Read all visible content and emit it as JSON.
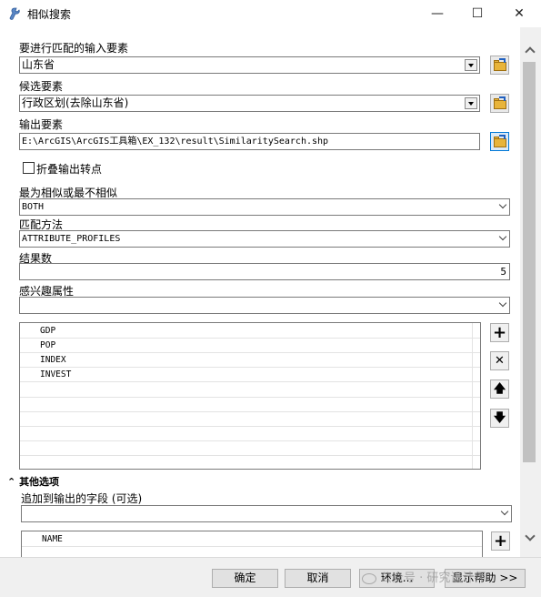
{
  "window": {
    "title": "相似搜索",
    "minimize_glyph": "—",
    "maximize_glyph": "☐",
    "close_glyph": "✕"
  },
  "fields": {
    "input_features": {
      "label": "要进行匹配的输入要素",
      "value": "山东省"
    },
    "candidate_features": {
      "label": "候选要素",
      "value": "行政区划(去除山东省)"
    },
    "output_features": {
      "label": "输出要素",
      "value": "E:\\ArcGIS\\ArcGIS工具箱\\EX_132\\result\\SimilaritySearch.shp"
    },
    "collapse_checkbox": {
      "label": "折叠输出转点",
      "checked": false
    },
    "most_or_least": {
      "label": "最为相似或最不相似",
      "value": "BOTH"
    },
    "match_method": {
      "label": "匹配方法",
      "value": "ATTRIBUTE_PROFILES"
    },
    "result_count": {
      "label": "结果数",
      "value": "5"
    },
    "interest_attrs": {
      "label": "感兴趣属性",
      "value": ""
    }
  },
  "attributes_list": [
    "GDP",
    "POP",
    "INDEX",
    "INVEST"
  ],
  "side_buttons": {
    "add": "+",
    "remove": "✕",
    "up": "🡅",
    "down": "🡇"
  },
  "other_options": {
    "toggle_glyph": "⌃",
    "header": "其他选项",
    "append_fields_label": "追加到输出的字段 (可选)",
    "append_fields_value": "",
    "append_list": [
      "NAME"
    ],
    "add_glyph": "+"
  },
  "buttons": {
    "ok": "确定",
    "cancel": "取消",
    "environments": "环境...",
    "show_help": "显示帮助 >>"
  },
  "watermark": "公众号 · 研究设计师",
  "colors": {
    "accent": "#0078d7",
    "folder": "#e8b43a"
  }
}
